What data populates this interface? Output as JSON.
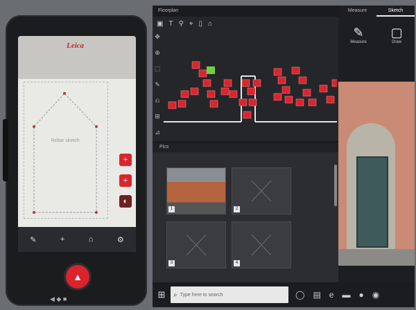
{
  "device": {
    "logo": "Leica",
    "sketch_label": "Rebar sketch",
    "buttons": [
      "+",
      "+",
      "◐"
    ],
    "toolbar": [
      "✎",
      "+",
      "⌂",
      "⚙"
    ],
    "shutter_icon": "▲",
    "bottom_label": "◀ ◆ ■"
  },
  "laptop": {
    "left_window": {
      "title": "Floorplan",
      "toolbar_icons": [
        "▣",
        "T",
        "⚲",
        "⌖",
        "▯",
        "⌂"
      ],
      "tool_icons": [
        "✥",
        "⊕",
        "⬚",
        "✎",
        "⎌",
        "⊞",
        "⊿"
      ],
      "photos_title": "Pics",
      "thumb_numbers": [
        "1",
        "2",
        "3",
        "4"
      ]
    },
    "right_window": {
      "tabs": [
        "Measure",
        "Sketch"
      ],
      "tools": [
        {
          "icon": "✎",
          "label": "Measure"
        },
        {
          "icon": "▢",
          "label": "Draw"
        }
      ]
    },
    "taskbar": {
      "search_placeholder": "Type here to search",
      "icons": [
        "◯",
        "▤",
        "e",
        "▬",
        "●",
        "◉"
      ]
    }
  },
  "colors": {
    "accent_red": "#d8262e",
    "marker_green": "#6fd13a",
    "wall_white": "#e6e6e6"
  }
}
